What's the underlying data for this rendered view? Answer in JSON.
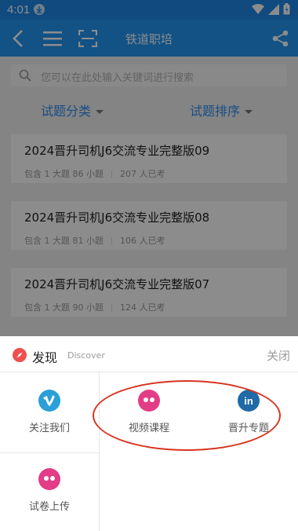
{
  "status_bar": {
    "time": "4:01"
  },
  "app_bar": {
    "title": "铁道职培"
  },
  "search": {
    "placeholder": "您可以在此处输入关键词进行搜索"
  },
  "filters": [
    {
      "label": "试题分类"
    },
    {
      "label": "试题排序"
    }
  ],
  "cards": [
    {
      "title": "2024晋升司机J6交流专业完整版09",
      "contains": "包含 1 大题 86 小题",
      "takers": "207 人已考"
    },
    {
      "title": "2024晋升司机J6交流专业完整版08",
      "contains": "包含 1 大题 81 小题",
      "takers": "106 人已考"
    },
    {
      "title": "2024晋升司机J6交流专业完整版07",
      "contains": "包含 1 大题 90 小题",
      "takers": "124 人已考"
    }
  ],
  "sheet": {
    "title": "发现",
    "subtitle": "Discover",
    "close_label": "关闭",
    "items": [
      {
        "label": "关注我们",
        "icon": "vimeo-icon",
        "color": "#2a9fd8"
      },
      {
        "label": "视频课程",
        "icon": "flickr-icon",
        "color": "#e23d86"
      },
      {
        "label": "晋升专题",
        "icon": "linkedin-icon",
        "color": "#1f6aa7"
      },
      {
        "label": "试卷上传",
        "icon": "flickr-icon",
        "color": "#e23d86"
      }
    ]
  },
  "colors": {
    "primary": "#2196f3",
    "accent_text": "#2d8cf0",
    "highlight": "#d8341f"
  }
}
